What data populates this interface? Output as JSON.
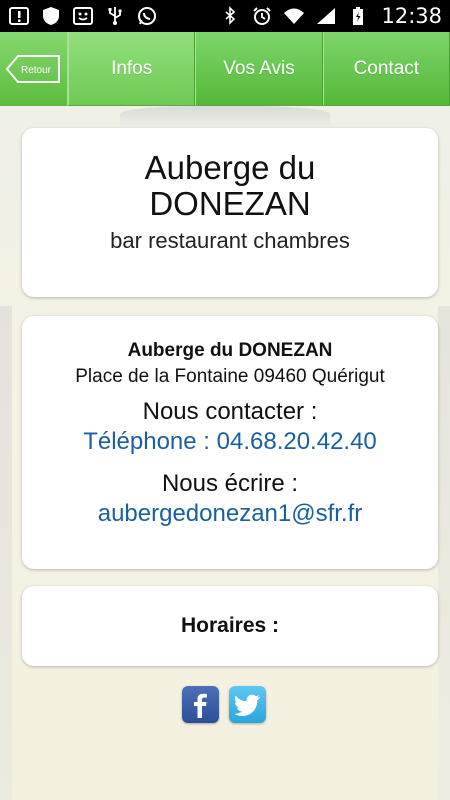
{
  "status_bar": {
    "time": "12:38",
    "icons_left": [
      "alert-icon",
      "shield-icon",
      "face-icon",
      "usb-icon",
      "whatsapp-icon"
    ],
    "icons_right": [
      "bluetooth-icon",
      "alarm-icon",
      "wifi-icon",
      "signal-icon",
      "battery-icon"
    ]
  },
  "nav": {
    "back_label": "Retour",
    "tabs": [
      {
        "label": "Infos",
        "active": true
      },
      {
        "label": "Vos Avis",
        "active": false
      },
      {
        "label": "Contact",
        "active": false
      }
    ],
    "accent": "#5cbc3f"
  },
  "title_card": {
    "line1": "Auberge du",
    "line2": "DONEZAN",
    "subtitle": "bar restaurant chambres"
  },
  "contact_card": {
    "name": "Auberge du DONEZAN",
    "address": "Place de la Fontaine 09460 Quérigut",
    "contact_heading": "Nous contacter :",
    "phone": "Téléphone : 04.68.20.42.40",
    "write_heading": "Nous écrire :",
    "email": "aubergedonezan1@sfr.fr",
    "link_color": "#1b5fa3"
  },
  "hours_card": {
    "label": "Horaires :"
  },
  "social": {
    "facebook": "facebook-icon",
    "twitter": "twitter-icon"
  }
}
